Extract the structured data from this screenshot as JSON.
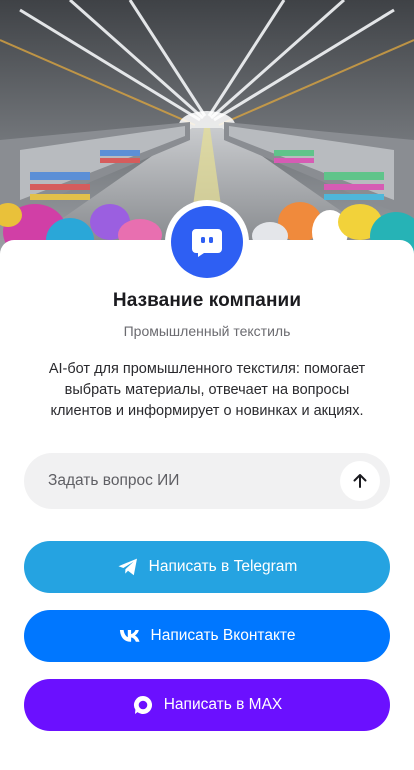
{
  "company": {
    "name": "Название компании",
    "category": "Промышленный текстиль",
    "description": "AI-бот для промышленного текстиля: помогает выбрать материалы, отвечает на вопросы клиентов и информирует о новинках и акциях."
  },
  "ask": {
    "placeholder": "Задать вопрос ИИ"
  },
  "buttons": {
    "telegram": "Написать в Telegram",
    "vk": "Написать Вконтакте",
    "max": "Написать в MAX"
  },
  "colors": {
    "avatar": "#2e5ff3",
    "telegram": "#25a3e1",
    "vk": "#0077ff",
    "max": "#6b10ff"
  },
  "icons": {
    "avatar": "chat-bot-icon",
    "send": "arrow-up-icon",
    "telegram": "telegram-icon",
    "vk": "vk-icon",
    "max": "max-icon"
  }
}
